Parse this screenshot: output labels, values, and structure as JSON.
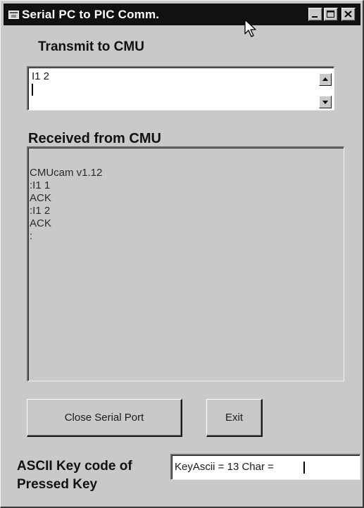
{
  "window": {
    "title": "Serial PC to PIC Comm."
  },
  "transmit": {
    "label": "Transmit to CMU",
    "lines": [
      "I1 2"
    ]
  },
  "received": {
    "label": "Received from CMU",
    "lines": [
      "CMUcam v1.12",
      ":I1 1",
      "ACK",
      ":I1 2",
      "ACK",
      ":"
    ]
  },
  "buttons": {
    "close_port": "Close Serial Port",
    "exit": "Exit"
  },
  "ascii": {
    "label_line1": "ASCII Key code of",
    "label_line2": "Pressed Key",
    "value": "KeyAscii =  13 Char ="
  }
}
